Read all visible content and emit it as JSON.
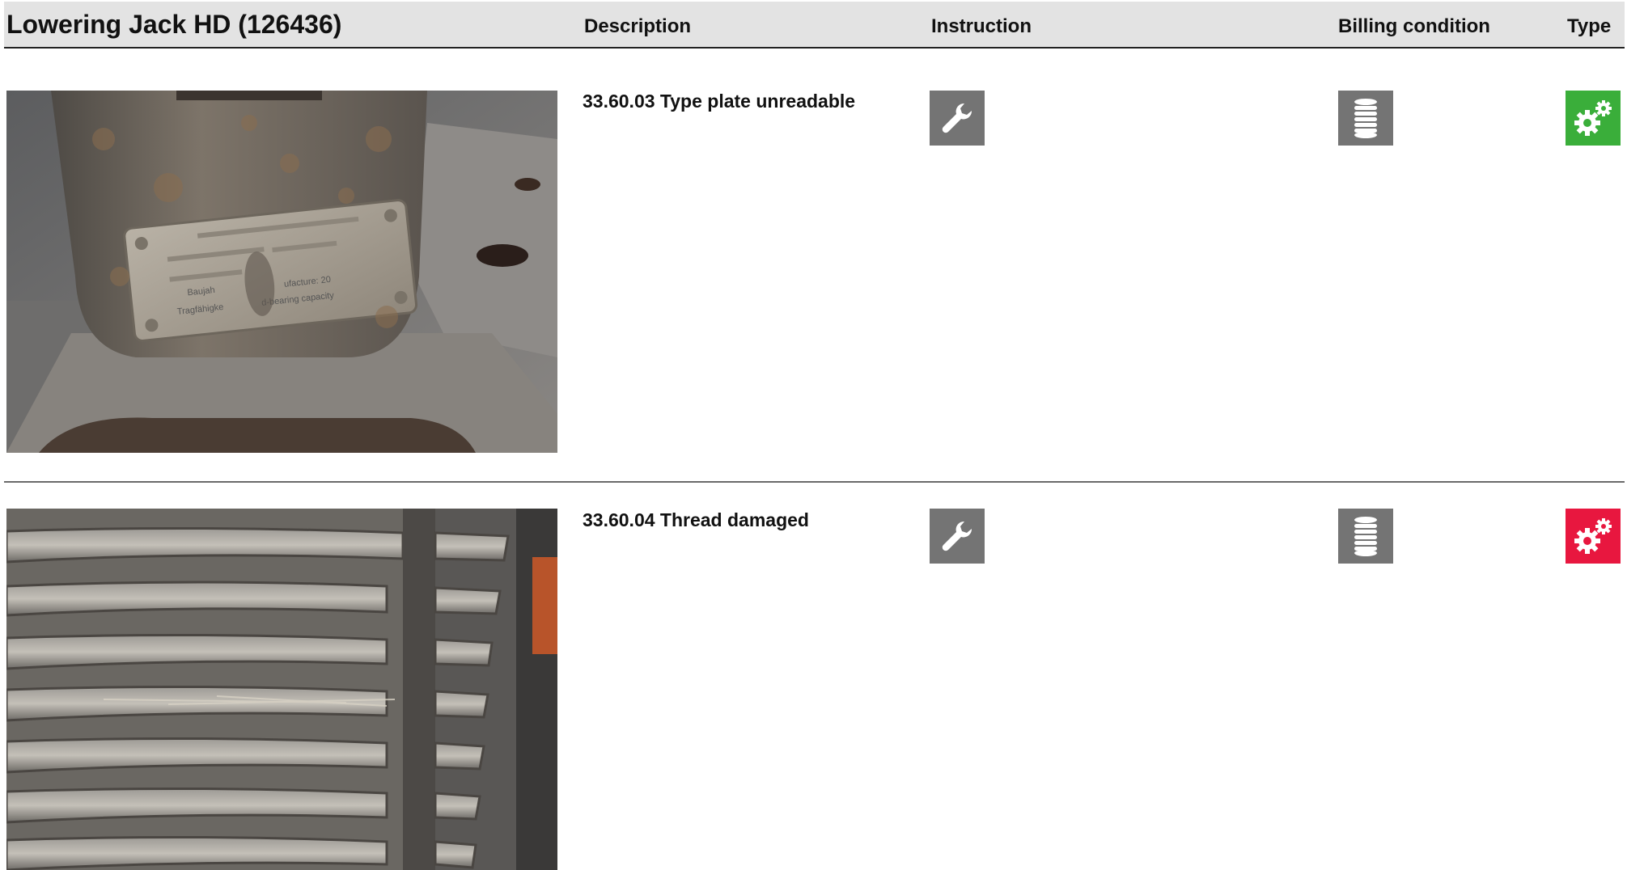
{
  "header": {
    "title": "Lowering Jack HD (126436)",
    "columns": {
      "description": "Description",
      "instruction": "Instruction",
      "billing_condition": "Billing condition",
      "type": "Type"
    }
  },
  "items": [
    {
      "description": "33.60.03 Type plate unreadable",
      "photo": "type-plate-photo",
      "instruction_icon": "wrench-icon",
      "billing_icon": "coin-stack-icon",
      "type_icon": "gears-icon",
      "type_color": "#3aae3a"
    },
    {
      "description": "33.60.04 Thread damaged",
      "photo": "thread-photo",
      "instruction_icon": "wrench-icon",
      "billing_icon": "coin-stack-icon",
      "type_icon": "gears-icon",
      "type_color": "#e8173f"
    }
  ],
  "photo_text": {
    "plate_line_5": "Tragfähigke",
    "plate_line_5b": "d-bearing capacity",
    "plate_line_4": "Baujah",
    "plate_line_4b": "ufacture: 20"
  }
}
